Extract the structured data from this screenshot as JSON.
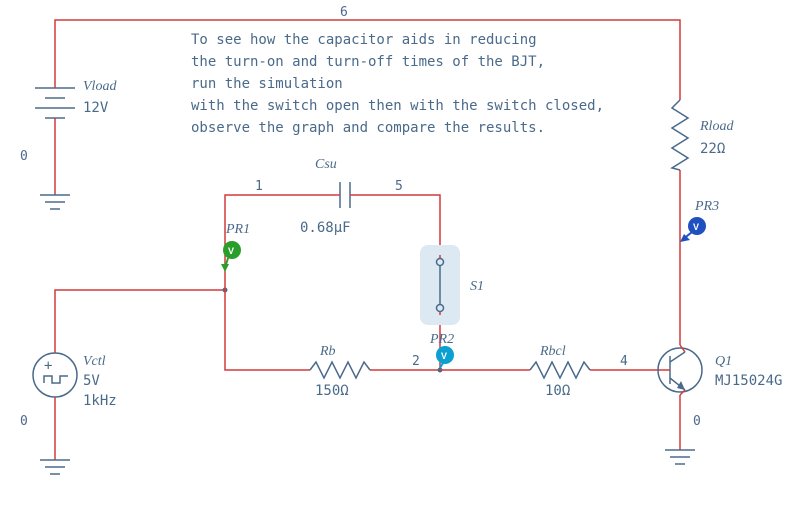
{
  "description": {
    "line1": "To see how the capacitor aids in reducing",
    "line2": "the turn-on and turn-off times of the BJT,",
    "line3": "run the simulation",
    "line4": "with the switch open then with the switch closed,",
    "line5": "observe the graph and compare the results."
  },
  "components": {
    "Vload": {
      "name": "Vload",
      "value": "12V",
      "node_bottom": "0"
    },
    "Vctl": {
      "name": "Vctl",
      "value": "5V",
      "freq": "1kHz",
      "node_bottom": "0"
    },
    "Csu": {
      "name": "Csu",
      "value": "0.68µF"
    },
    "Rb": {
      "name": "Rb",
      "value": "150Ω"
    },
    "Rbcl": {
      "name": "Rbcl",
      "value": "10Ω"
    },
    "Rload": {
      "name": "Rload",
      "value": "22Ω"
    },
    "S1": {
      "name": "S1"
    },
    "Q1": {
      "name": "Q1",
      "model": "MJ15024G",
      "node_emitter": "0"
    }
  },
  "nodes": {
    "n1": "1",
    "n2": "2",
    "n4": "4",
    "n5": "5",
    "n6": "6"
  },
  "probes": {
    "PR1": {
      "name": "PR1",
      "type": "V"
    },
    "PR2": {
      "name": "PR2",
      "type": "V"
    },
    "PR3": {
      "name": "PR3",
      "type": "V"
    }
  }
}
